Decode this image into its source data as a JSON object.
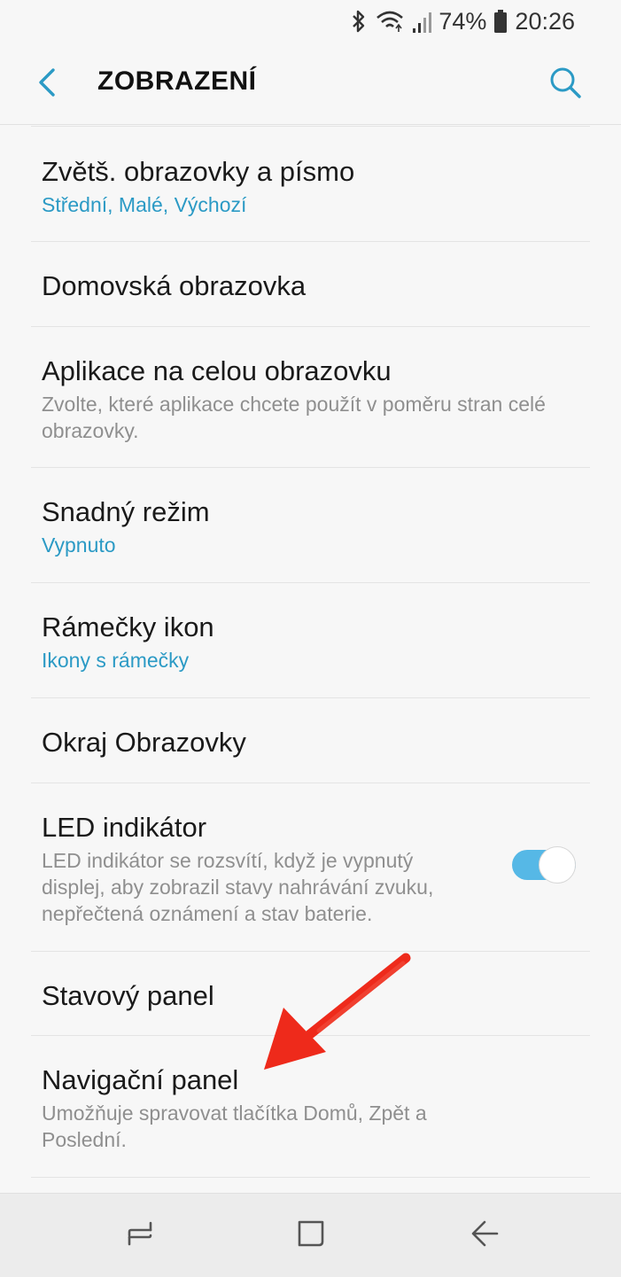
{
  "status_bar": {
    "battery": "74%",
    "time": "20:26",
    "icons": [
      "bluetooth-icon",
      "wifi-icon",
      "signal-icon",
      "battery-icon"
    ]
  },
  "app_bar": {
    "title": "ZOBRAZENÍ",
    "back_icon": "chevron-left-icon",
    "search_icon": "search-icon"
  },
  "settings": [
    {
      "title": "Zvětš. obrazovky a písmo",
      "subtitle": "Střední, Malé, Výchozí",
      "subtitle_style": "accent"
    },
    {
      "title": "Domovská obrazovka"
    },
    {
      "title": "Aplikace na celou obrazovku",
      "subtitle": "Zvolte, které aplikace chcete použít v poměru stran celé obrazovky.",
      "subtitle_style": "muted"
    },
    {
      "title": "Snadný režim",
      "subtitle": "Vypnuto",
      "subtitle_style": "accent"
    },
    {
      "title": "Rámečky ikon",
      "subtitle": "Ikony s rámečky",
      "subtitle_style": "accent"
    },
    {
      "title": "Okraj Obrazovky"
    },
    {
      "title": "LED indikátor",
      "subtitle": "LED indikátor se rozsvítí, když je vypnutý displej, aby zobrazil stavy nahrávání zvuku, nepřečtená oznámení a stav baterie.",
      "subtitle_style": "muted",
      "toggle": true
    },
    {
      "title": "Stavový panel"
    },
    {
      "title": "Navigační panel",
      "subtitle": "Umožňuje spravovat tlačítka Domů, Zpět a Poslední.",
      "subtitle_style": "muted"
    }
  ],
  "nav_bar": {
    "recents_icon": "recents-icon",
    "home_icon": "home-icon",
    "back_icon": "back-arrow-icon"
  },
  "colors": {
    "accent": "#2b9ac5",
    "toggle_on": "#56b8e6",
    "annotation_red": "#ee2a1b",
    "background": "#f7f7f7"
  }
}
